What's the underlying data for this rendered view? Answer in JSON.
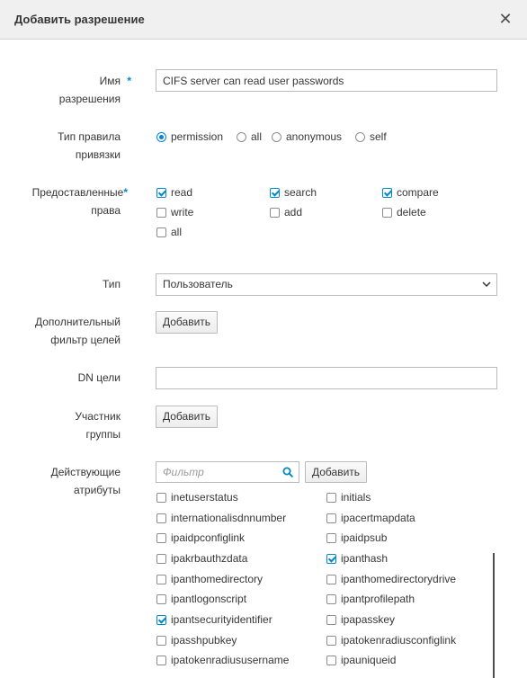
{
  "dialog": {
    "title": "Добавить разрешение",
    "close_icon": "close-icon"
  },
  "name_field": {
    "label_line1": "Имя",
    "label_line2": "разрешения",
    "required_mark": "*",
    "value": "CIFS server can read user passwords"
  },
  "bind_type": {
    "label_line1": "Тип правила",
    "label_line2": "привязки",
    "options": [
      {
        "label": "permission",
        "selected": true
      },
      {
        "label": "all",
        "selected": false
      },
      {
        "label": "anonymous",
        "selected": false
      },
      {
        "label": "self",
        "selected": false
      }
    ]
  },
  "rights": {
    "label_line1": "Предоставленные",
    "label_line2": "права",
    "required_mark": "*",
    "options": [
      {
        "label": "read",
        "checked": true
      },
      {
        "label": "search",
        "checked": true
      },
      {
        "label": "compare",
        "checked": true
      },
      {
        "label": "write",
        "checked": false
      },
      {
        "label": "add",
        "checked": false
      },
      {
        "label": "delete",
        "checked": false
      },
      {
        "label": "all",
        "checked": false
      }
    ]
  },
  "type_field": {
    "label": "Тип",
    "value": "Пользователь"
  },
  "extra_filter": {
    "label_line1": "Дополнительный",
    "label_line2": "фильтр целей",
    "button": "Добавить"
  },
  "target_dn": {
    "label": "DN цели",
    "value": ""
  },
  "member_group": {
    "label_line1": "Участник",
    "label_line2": "группы",
    "button": "Добавить"
  },
  "attributes": {
    "label_line1": "Действующие",
    "label_line2": "атрибуты",
    "filter_placeholder": "Фильтр",
    "add_button": "Добавить",
    "items": [
      {
        "label": "inetuserstatus",
        "checked": false
      },
      {
        "label": "initials",
        "checked": false
      },
      {
        "label": "internationalisdnnumber",
        "checked": false
      },
      {
        "label": "ipacertmapdata",
        "checked": false
      },
      {
        "label": "ipaidpconfiglink",
        "checked": false
      },
      {
        "label": "ipaidpsub",
        "checked": false
      },
      {
        "label": "ipakrbauthzdata",
        "checked": false
      },
      {
        "label": "ipanthash",
        "checked": true
      },
      {
        "label": "ipanthomedirectory",
        "checked": false
      },
      {
        "label": "ipanthomedirectorydrive",
        "checked": false
      },
      {
        "label": "ipantlogonscript",
        "checked": false
      },
      {
        "label": "ipantprofilepath",
        "checked": false
      },
      {
        "label": "ipantsecurityidentifier",
        "checked": true
      },
      {
        "label": "ipapasskey",
        "checked": false
      },
      {
        "label": "ipasshpubkey",
        "checked": false
      },
      {
        "label": "ipatokenradiusconfiglink",
        "checked": false
      },
      {
        "label": "ipatokenradiususername",
        "checked": false
      },
      {
        "label": "ipauniqueid",
        "checked": false
      }
    ]
  }
}
